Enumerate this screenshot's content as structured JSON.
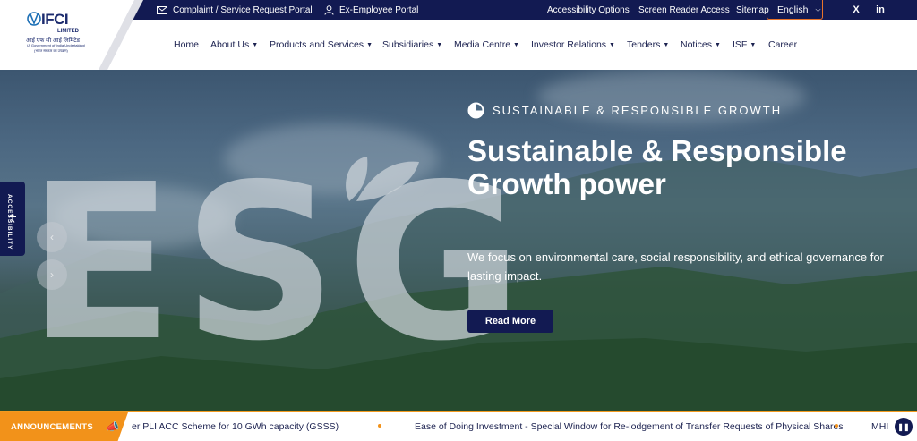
{
  "topbar": {
    "complaint_portal": "Complaint / Service Request Portal",
    "ex_employee_portal": "Ex-Employee Portal",
    "accessibility_options": "Accessibility Options",
    "screen_reader_access": "Screen Reader Access",
    "sitemap": "Sitemap",
    "language": "English",
    "social": {
      "x": "X",
      "linkedin": "in"
    }
  },
  "logo": {
    "word": "IFCI",
    "limited": "LIMITED",
    "hindi": "आई एफ सी आई लिमिटेड",
    "sub1": "(A Government of India Undertaking)",
    "sub2": "(भारत सरकार का उपक्रम)"
  },
  "nav": {
    "items": [
      {
        "label": "Home",
        "has_dropdown": false
      },
      {
        "label": "About Us",
        "has_dropdown": true
      },
      {
        "label": "Products and Services",
        "has_dropdown": true
      },
      {
        "label": "Subsidiaries",
        "has_dropdown": true
      },
      {
        "label": "Media Centre",
        "has_dropdown": true
      },
      {
        "label": "Investor Relations",
        "has_dropdown": true
      },
      {
        "label": "Tenders",
        "has_dropdown": true
      },
      {
        "label": "Notices",
        "has_dropdown": true
      },
      {
        "label": "ISF",
        "has_dropdown": true
      },
      {
        "label": "Career",
        "has_dropdown": false
      }
    ]
  },
  "hero": {
    "background_text": "ESG",
    "tagline": "SUSTAINABLE & RESPONSIBLE GROWTH",
    "title": "Sustainable & Responsible Growth power",
    "description": "We focus on environmental care, social responsibility, and ethical governance for lasting impact.",
    "cta": "Read More",
    "prev_icon": "‹",
    "next_icon": "›"
  },
  "accessibility_tab": {
    "label": "ACCESSIBILITY"
  },
  "announcements": {
    "label": "ANNOUNCEMENTS",
    "items": [
      "er PLI ACC Scheme for 10 GWh capacity (GSSS)",
      "Ease of Doing Investment - Special Window for Re-lodgement of Transfer Requests of Physical Shares",
      "MHI"
    ]
  },
  "colors": {
    "navy": "#121a52",
    "orange": "#f2921a",
    "white": "#ffffff"
  }
}
